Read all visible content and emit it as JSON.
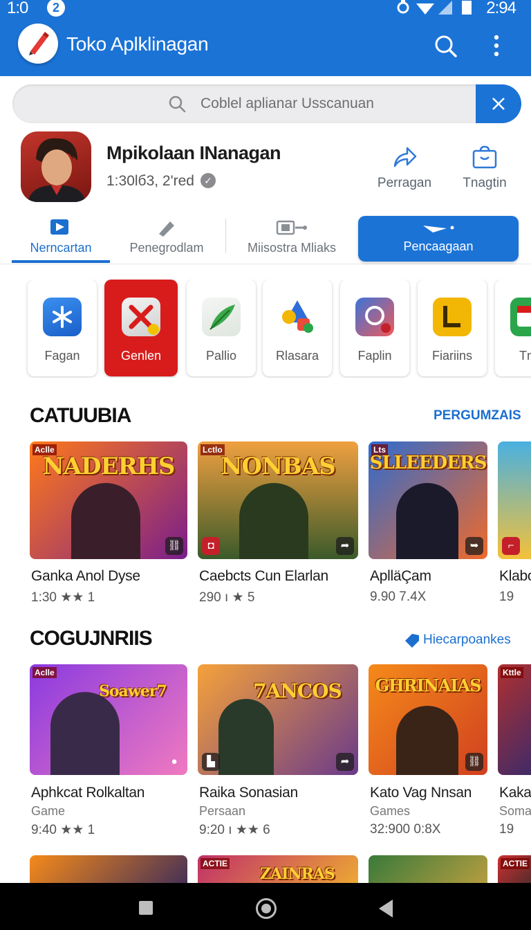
{
  "status_bar": {
    "time": "1:0",
    "badge": "2",
    "clock": "2:94"
  },
  "app_bar": {
    "title": "Toko Aplklinagan"
  },
  "search": {
    "placeholder": "Coblel aplianar Usscanuan"
  },
  "app_header": {
    "name": "Mpikolaan INanagan",
    "meta": "1:30lб3, 2'red",
    "actions": [
      {
        "label": "Perragan",
        "icon": "share-icon"
      },
      {
        "label": "Tnagtin",
        "icon": "bag-icon"
      }
    ]
  },
  "tabs": [
    {
      "label": "Nerncartan",
      "icon": "video-icon",
      "active": true
    },
    {
      "label": "Penegrodlam",
      "icon": "pen-icon"
    },
    {
      "label": "Miisostra Mliaks",
      "icon": "gallery-icon"
    },
    {
      "label": "Pencaagaan",
      "icon": "plane-icon",
      "highlight": true
    }
  ],
  "categories": [
    {
      "label": "Fagan",
      "icon": "asterisk-icon",
      "color": "#1f7be0"
    },
    {
      "label": "Genlen",
      "icon": "x-icon",
      "color": "#d81c1c"
    },
    {
      "label": "Pallio",
      "icon": "feather-icon",
      "color": "#3aa84a"
    },
    {
      "label": "Rlasara",
      "icon": "shapes-icon",
      "color": "#e84b3c"
    },
    {
      "label": "Faplin",
      "icon": "link-icon",
      "color": "#3b74d8"
    },
    {
      "label": "Fiariins",
      "icon": "l-icon",
      "color": "#f2b705"
    },
    {
      "label": "Tnç",
      "icon": "app-icon",
      "color": "#2aa54a"
    }
  ],
  "section1": {
    "title": "CATUUBIA",
    "link": "PERGUMZAIS",
    "items": [
      {
        "thumb_title": "NADERHS",
        "tag": "Aclle",
        "name": "Ganka Anol Dyse",
        "rating": "1:30 ★★ 1",
        "colors": [
          "#ff7a1a",
          "#7a1e8c"
        ]
      },
      {
        "thumb_title": "NONBAS",
        "tag": "Lctlo",
        "name": "Caebcts Cun Elarlan",
        "rating": "290 ı ★ 5",
        "colors": [
          "#f0a040",
          "#3b5a2a"
        ]
      },
      {
        "thumb_title": "SLLEEDERS",
        "tag": "Lts",
        "name": "AplläÇam",
        "rating": "9.90      7.4X",
        "colors": [
          "#2e6bd0",
          "#f06a2a"
        ]
      },
      {
        "thumb_title": "",
        "tag": "",
        "name": "Klabo",
        "rating": "19",
        "colors": [
          "#49b0e0",
          "#f4c13a"
        ]
      }
    ]
  },
  "section2": {
    "title": "COGUJNRIIS",
    "link": "Hiecarpoankes",
    "items": [
      {
        "thumb_title": "Soawer7",
        "tag": "Aclle",
        "name": "Aphkcat Rolkaltan",
        "sub": "Game",
        "rating": "9:40 ★★ 1",
        "colors": [
          "#8a3ae0",
          "#f07ac0"
        ]
      },
      {
        "thumb_title": "7ANCOS",
        "tag": "",
        "name": "Raika Sonasian",
        "sub": "Persaan",
        "rating": "9:20 ı ★★ 6",
        "colors": [
          "#f5a23a",
          "#6a3a8a"
        ]
      },
      {
        "thumb_title": "GHRINAIAS",
        "tag": "",
        "name": "Kato Vag Nnsan",
        "sub": "Games",
        "rating": "32:900      0:8X",
        "colors": [
          "#f58a1a",
          "#d04020"
        ]
      },
      {
        "thumb_title": "",
        "tag": "Kttle",
        "name": "Kaka",
        "sub": "Soma",
        "rating": "19",
        "colors": [
          "#b03030",
          "#3a2a6a"
        ]
      }
    ]
  },
  "section3": {
    "items": [
      {
        "thumb_title": "",
        "tag": "",
        "colors": [
          "#f58a1a",
          "#3a2a5a"
        ]
      },
      {
        "thumb_title": "ZAINRAS",
        "tag": "ACTIE",
        "colors": [
          "#c0306a",
          "#f0b030"
        ]
      },
      {
        "thumb_title": "",
        "tag": "",
        "colors": [
          "#3a7a3a",
          "#c0a040"
        ]
      },
      {
        "thumb_title": "",
        "tag": "ACTIE",
        "colors": [
          "#d03030",
          "#2a2a2a"
        ]
      }
    ]
  }
}
